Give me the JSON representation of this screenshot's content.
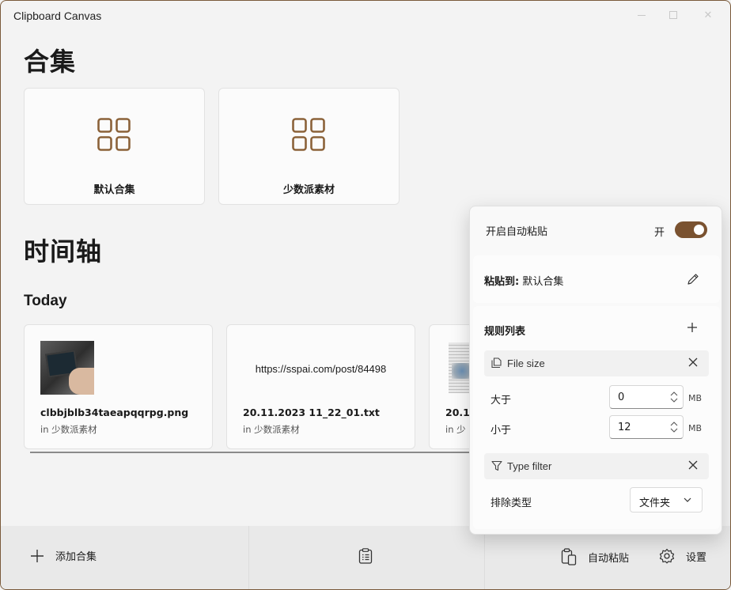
{
  "window": {
    "title": "Clipboard Canvas"
  },
  "collections": {
    "heading": "合集",
    "items": [
      {
        "label": "默认合集"
      },
      {
        "label": "少数派素材"
      }
    ]
  },
  "timeline": {
    "heading": "时间轴",
    "group_label": "Today",
    "items": [
      {
        "name": "clbbjblb34taeapqqrpg.png",
        "sub": "in 少数派素材"
      },
      {
        "preview": "https://sspai.com/post/84498",
        "name": "20.11.2023 11_22_01.txt",
        "sub": "in 少数派素材"
      },
      {
        "name": "20.1",
        "sub": "in 少"
      }
    ]
  },
  "bottombar": {
    "add_collection": "添加合集",
    "auto_paste": "自动粘贴",
    "settings": "设置"
  },
  "autopaste_flyout": {
    "enable_label": "开启自动粘贴",
    "toggle_state_text": "开",
    "toggle_on": true,
    "paste_to_label": "粘贴到:",
    "paste_to_value": "默认合集",
    "rules_title": "规则列表",
    "rules": {
      "file_size": {
        "name": "File size",
        "greater_label": "大于",
        "greater_value": "0",
        "less_label": "小于",
        "less_value": "12",
        "unit": "MB"
      },
      "type_filter": {
        "name": "Type filter",
        "exclude_label": "排除类型",
        "exclude_value": "文件夹"
      }
    }
  },
  "colors": {
    "accent": "#7a5230",
    "icon": "#8b6239"
  }
}
